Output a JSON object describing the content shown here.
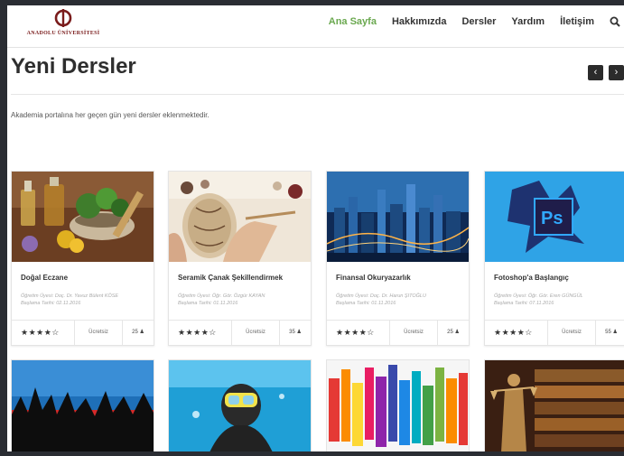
{
  "brand": {
    "logo_text": "ANADOLU ÜNİVERSİTESİ"
  },
  "nav": {
    "items": [
      "Ana Sayfa",
      "Hakkımızda",
      "Dersler",
      "Yardım",
      "İletişim"
    ],
    "active": "Ana Sayfa",
    "active_color": "#6aa84f"
  },
  "page": {
    "title": "Yeni Dersler",
    "description": "Akademia portalına her geçen gün yeni dersler eklenmektedir.",
    "prev_glyph": "‹",
    "next_glyph": "›"
  },
  "courses": [
    {
      "title": "Doğal Eczane",
      "instructor": "Öğretim Üyesi: Doç. Dr. Yavuz Bülent KÖSE",
      "start": "Başlama Tarihi: 02.11.2016",
      "rating": 4,
      "rating_text": "★★★★☆",
      "price": "Ücretsiz",
      "count": "25 ♟"
    },
    {
      "title": "Seramik Çanak Şekillendirmek",
      "instructor": "Öğretim Üyesi: Öğr. Gör. Özgür KAYAN",
      "start": "Başlama Tarihi: 01.11.2016",
      "rating": 4,
      "rating_text": "★★★★☆",
      "price": "Ücretsiz",
      "count": "35 ♟"
    },
    {
      "title": "Finansal Okuryazarlık",
      "instructor": "Öğretim Üyesi: Doç. Dr. Harun ŞITOĞLU",
      "start": "Başlama Tarihi: 01.11.2016",
      "rating": 4,
      "rating_text": "★★★★☆",
      "price": "Ücretsiz",
      "count": "25 ♟"
    },
    {
      "title": "Fotoshop'a Başlangıç",
      "instructor": "Öğretim Üyesi: Öğr. Gör. Eren GÜNGÜL",
      "start": "Başlama Tarihi: 07.11.2016",
      "rating": 4,
      "rating_text": "★★★★☆",
      "price": "Ücretsiz",
      "count": "55 ♟"
    }
  ],
  "second_row_icons": [
    "concert-image",
    "scuba-diver-image",
    "colorful-bars-image",
    "justice-statue-image"
  ],
  "colors": {
    "accent": "#6aa84f",
    "brand": "#7a1c1c",
    "photoshop_blue": "#2fa3e6",
    "photoshop_dark": "#1f1d4a"
  }
}
